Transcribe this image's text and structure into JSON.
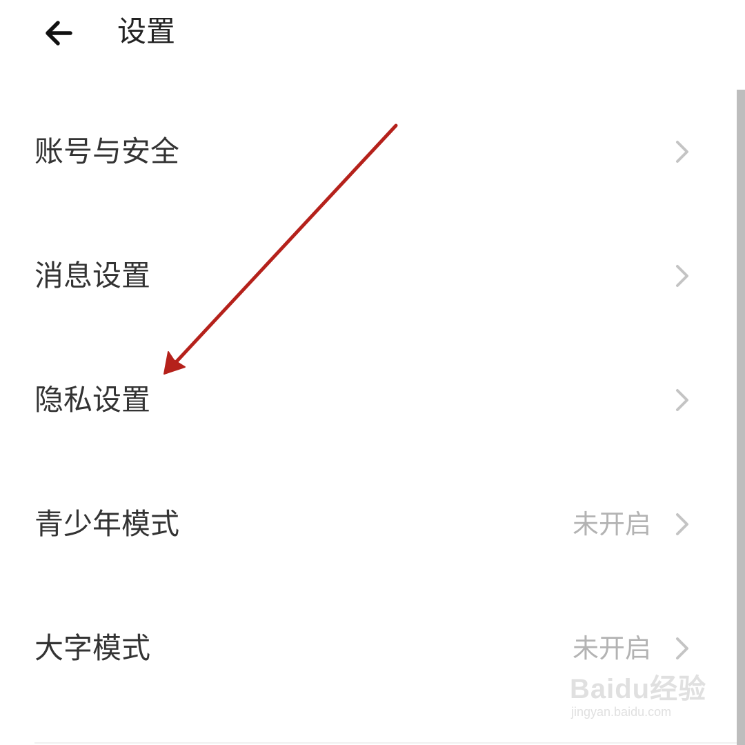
{
  "header": {
    "title": "设置",
    "back_icon": "arrow-left-icon"
  },
  "settings": {
    "items": [
      {
        "label": "账号与安全",
        "value": "",
        "icon": "chevron-right-icon"
      },
      {
        "label": "消息设置",
        "value": "",
        "icon": "chevron-right-icon"
      },
      {
        "label": "隐私设置",
        "value": "",
        "icon": "chevron-right-icon"
      },
      {
        "label": "青少年模式",
        "value": "未开启",
        "icon": "chevron-right-icon"
      },
      {
        "label": "大字模式",
        "value": "未开启",
        "icon": "chevron-right-icon"
      }
    ]
  },
  "annotation": {
    "type": "arrow",
    "color": "#b5211b",
    "points_to": "隐私设置"
  },
  "watermark": {
    "logo": "Baidu经验",
    "url": "jingyan.baidu.com"
  }
}
